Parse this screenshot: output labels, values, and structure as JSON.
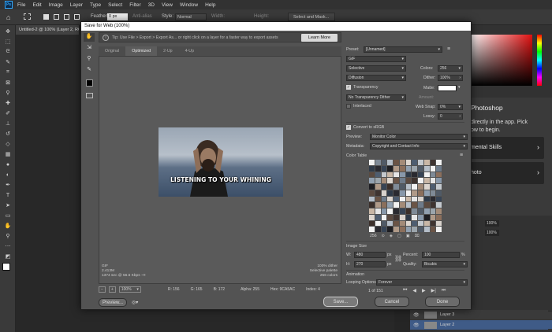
{
  "app": {
    "logo": "Ps",
    "menu": [
      "File",
      "Edit",
      "Image",
      "Layer",
      "Type",
      "Select",
      "Filter",
      "3D",
      "View",
      "Window",
      "Help"
    ]
  },
  "options_bar": {
    "feather_label": "Feather:",
    "feather_value": "0 px",
    "antialias_label": "Anti-alias",
    "style_label": "Style:",
    "style_value": "Normal",
    "width_label": "Width:",
    "height_label": "Height:",
    "select_mask_label": "Select and Mask..."
  },
  "document_tab": {
    "title": "Untitled-2 @ 100% (Layer 2, RGB/8)"
  },
  "dialog": {
    "title": "Save for Web (100%)",
    "tip": "Tip: Use File > Export > Export As...  or right click on a layer for a faster way to export assets",
    "learn_more": "Learn More",
    "tabs": [
      "Original",
      "Optimized",
      "2-Up",
      "4-Up"
    ],
    "active_tab": "Optimized",
    "image_caption": "LISTENING TO YOUR WHINING",
    "info_left": [
      "GIF",
      "2.413M",
      "1374 sec @ 56.6 Kbps  ~≡"
    ],
    "info_right": [
      "100% dither",
      "Selective palette",
      "256 colors"
    ],
    "zoom": "100%",
    "readout": {
      "r": "R: 156",
      "g": "G: 165",
      "b": "B: 172",
      "alpha": "Alpha: 255",
      "hex": "Hex: 9CA5AC",
      "index": "Index: 4"
    },
    "buttons": {
      "preview": "Preview...",
      "save": "Save...",
      "cancel": "Cancel",
      "done": "Done"
    },
    "settings": {
      "preset_label": "Preset:",
      "preset_value": "[Unnamed]",
      "format": "GIF",
      "reduction": "Selective",
      "colors_label": "Colors:",
      "colors_value": "256",
      "dither_algo": "Diffusion",
      "dither_label": "Dither:",
      "dither_value": "100%",
      "transparency_label": "Transparency",
      "matte_label": "Matte:",
      "transparency_dither": "No Transparency Dither",
      "amount_label": "Amount:",
      "interlaced_label": "Interlaced",
      "websnap_label": "Web Snap:",
      "websnap_value": "0%",
      "lossy_label": "Lossy:",
      "lossy_value": "0",
      "convert_srgb_label": "Convert to sRGB",
      "preview_label": "Preview:",
      "preview_value": "Monitor Color",
      "metadata_label": "Metadata:",
      "metadata_value": "Copyright and Contact Info",
      "color_table_label": "Color Table",
      "color_count": "256",
      "image_size_label": "Image Size",
      "w_label": "W:",
      "w_value": "480",
      "h_label": "H:",
      "h_value": "270",
      "px": "px",
      "percent_label": "Percent:",
      "percent_value": "100",
      "percent_unit": "%",
      "quality_label": "Quality:",
      "quality_value": "Bicubic",
      "animation_label": "Animation",
      "looping_label": "Looping Options:",
      "looping_value": "Forever",
      "frame_counter": "1 of 151"
    }
  },
  "right_panel": {
    "heading": "Photoshop",
    "text": "directly in the app. Pick",
    "text2": "ow to begin.",
    "card1": "mental Skills",
    "card2": "hoto",
    "layers": [
      "Layer 3",
      "Layer 2"
    ],
    "opacity_value": "100%",
    "fill_value": "100%"
  },
  "colors": {
    "accent": "#31a8ff",
    "dialog_bg": "#535353",
    "selected_layer": "#3f5b87"
  }
}
